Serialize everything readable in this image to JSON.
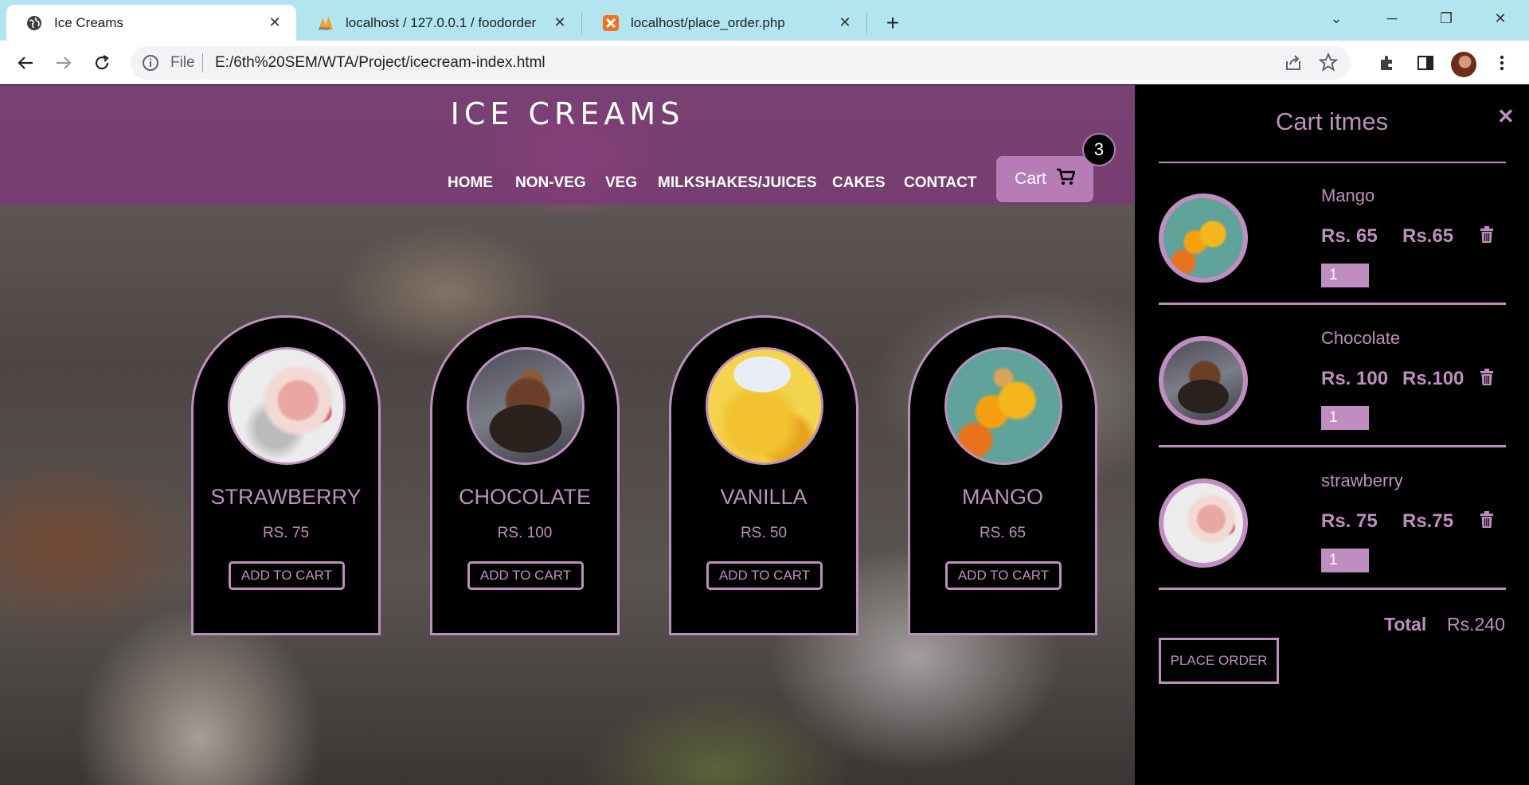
{
  "browser": {
    "tabs": [
      {
        "title": "Ice Creams",
        "active": true,
        "icon": "globe-icon"
      },
      {
        "title": "localhost / 127.0.0.1 / foodorder",
        "active": false,
        "icon": "phpmyadmin-icon"
      },
      {
        "title": "localhost/place_order.php",
        "active": false,
        "icon": "xampp-icon"
      }
    ],
    "address": {
      "scheme_label": "File",
      "url": "E:/6th%20SEM/WTA/Project/icecream-index.html"
    }
  },
  "site": {
    "title": "ICE CREAMS",
    "nav": [
      "HOME",
      "NON-VEG",
      "VEG",
      "MILKSHAKES/JUICES",
      "CAKES",
      "CONTACT"
    ],
    "cart_label": "Cart",
    "cart_count": "3"
  },
  "products": [
    {
      "name": "STRAWBERRY",
      "price": "RS. 75",
      "button": "ADD TO CART"
    },
    {
      "name": "CHOCOLATE",
      "price": "RS. 100",
      "button": "ADD TO CART"
    },
    {
      "name": "VANILLA",
      "price": "RS. 50",
      "button": "ADD TO CART"
    },
    {
      "name": "MANGO",
      "price": "RS. 65",
      "button": "ADD TO CART"
    }
  ],
  "cart": {
    "title": "Cart itmes",
    "items": [
      {
        "name": "Mango",
        "price": "Rs. 65",
        "total": "Rs.65",
        "qty": "1"
      },
      {
        "name": "Chocolate",
        "price": "Rs. 100",
        "total": "Rs.100",
        "qty": "1"
      },
      {
        "name": "strawberry",
        "price": "Rs. 75",
        "total": "Rs.75",
        "qty": "1"
      }
    ],
    "total_label": "Total",
    "total_value": "Rs.240",
    "place_order": "PLACE ORDER"
  },
  "colors": {
    "accent": "#c08dc0",
    "header": "#7e3778",
    "tabstrip": "#b3e5f1"
  }
}
